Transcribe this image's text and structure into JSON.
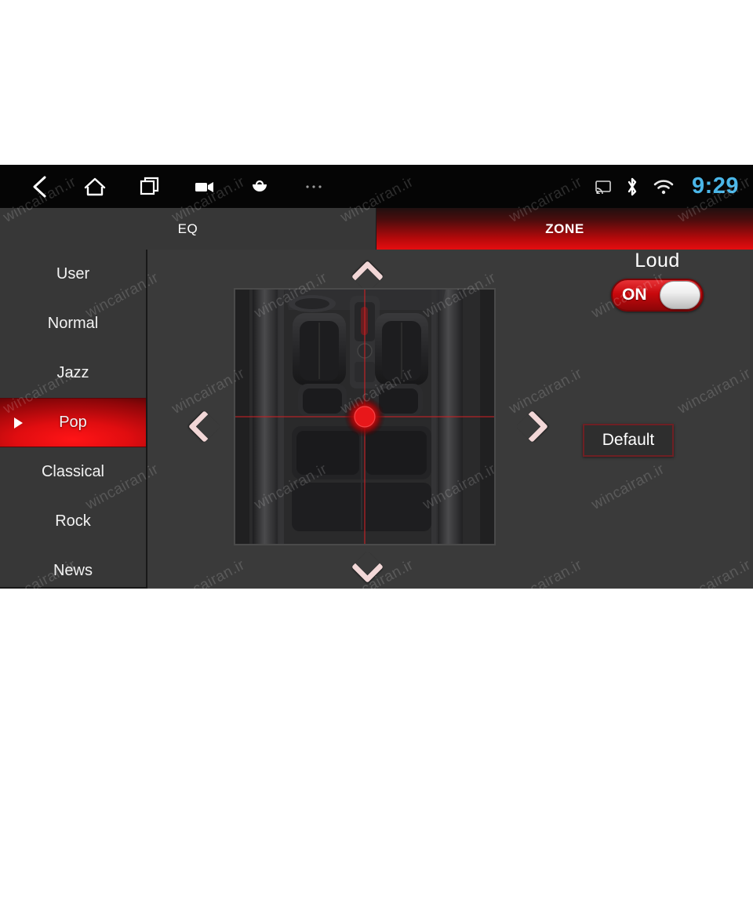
{
  "statusbar": {
    "nav_icons": [
      {
        "name": "back-icon",
        "glyph": "back"
      },
      {
        "name": "home-icon",
        "glyph": "home"
      },
      {
        "name": "recents-icon",
        "glyph": "recents"
      },
      {
        "name": "video-icon",
        "glyph": "video"
      },
      {
        "name": "apps-bag-icon",
        "glyph": "bag"
      },
      {
        "name": "overflow-icon",
        "glyph": "dots"
      }
    ],
    "system_icons": [
      {
        "name": "cast-icon",
        "glyph": "cast"
      },
      {
        "name": "bluetooth-icon",
        "glyph": "bluetooth"
      },
      {
        "name": "wifi-icon",
        "glyph": "wifi"
      }
    ],
    "clock": "9:29",
    "clock_color": "#4ab6e8"
  },
  "tabs": [
    {
      "label": "EQ",
      "active": false
    },
    {
      "label": "ZONE",
      "active": true
    }
  ],
  "sidebar": {
    "items": [
      {
        "label": "User",
        "selected": false
      },
      {
        "label": "Normal",
        "selected": false
      },
      {
        "label": "Jazz",
        "selected": false
      },
      {
        "label": "Pop",
        "selected": true
      },
      {
        "label": "Classical",
        "selected": false
      },
      {
        "label": "Rock",
        "selected": false
      },
      {
        "label": "News",
        "selected": false
      }
    ]
  },
  "zone": {
    "chevrons": [
      {
        "name": "zone-up-arrow",
        "dir": "up"
      },
      {
        "name": "zone-down-arrow",
        "dir": "down"
      },
      {
        "name": "zone-left-arrow",
        "dir": "left"
      },
      {
        "name": "zone-right-arrow",
        "dir": "right"
      }
    ],
    "seatmap_alt": "Car interior top view with seats and red crosshair focus point",
    "focus_color": "#e8171a",
    "loud": {
      "label": "Loud",
      "state": "ON"
    },
    "default_button": "Default"
  },
  "accent": {
    "red": "#e00d10",
    "panel_bg": "#3a3a3a",
    "sidebar_bg": "#373737",
    "statusbar_bg": "#050505"
  },
  "watermark": {
    "text": "wincairan.ir"
  }
}
